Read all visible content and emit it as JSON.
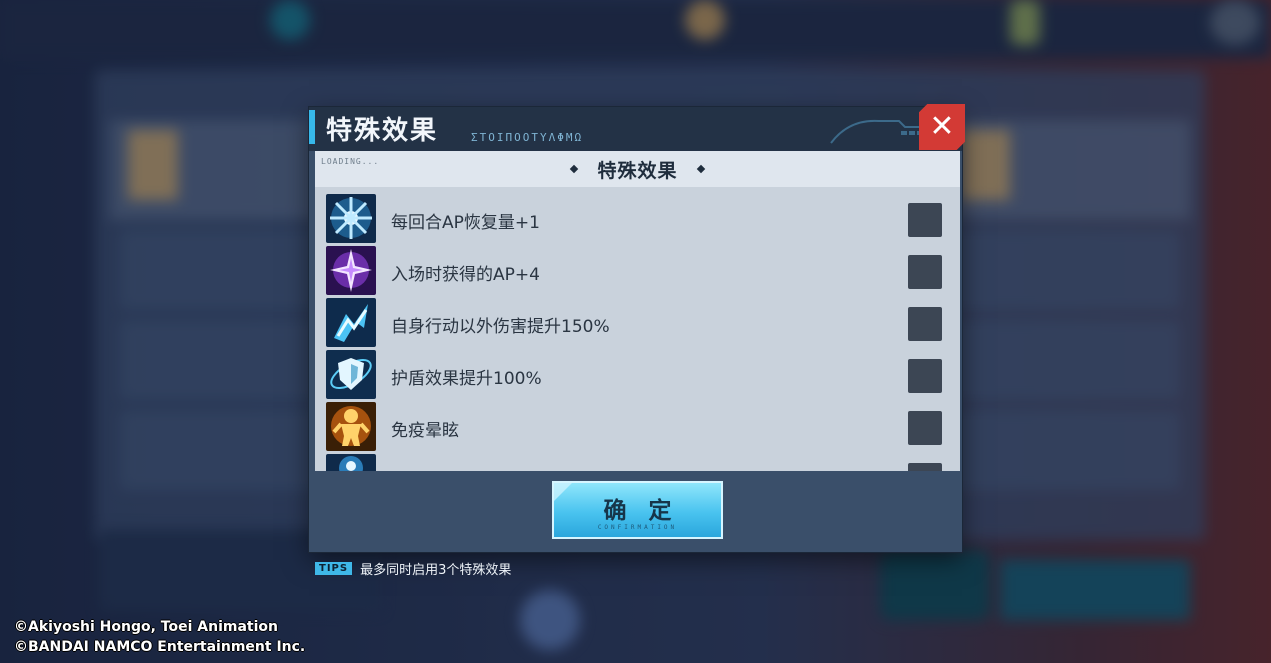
{
  "dialog": {
    "title": "特殊效果",
    "title_sub": "ΣΤΟΙΠΟΟΤΥΛΦΜΩ",
    "loading": "LOADING...",
    "subhead": "特殊效果",
    "effects": [
      {
        "label": "每回合AP恢复量+1",
        "icon": "burst-icon",
        "checked": false
      },
      {
        "label": "入场时获得的AP+4",
        "icon": "star-sparkle-icon",
        "checked": false
      },
      {
        "label": "自身行动以外伤害提升150%",
        "icon": "slash-icon",
        "checked": false
      },
      {
        "label": "护盾效果提升100%",
        "icon": "shield-icon",
        "checked": false
      },
      {
        "label": "免疫晕眩",
        "icon": "figure-icon",
        "checked": false
      },
      {
        "label": "",
        "icon": "partial-icon",
        "checked": false
      }
    ],
    "confirm_label": "确定",
    "confirm_sub": "CONFIRMATION"
  },
  "tips": {
    "tag": "TIPS",
    "text": "最多同时启用3个特殊效果"
  },
  "copyright": {
    "line1": "©Akiyoshi Hongo, Toei Animation",
    "line2": "©BANDAI NAMCO Entertainment Inc."
  },
  "colors": {
    "accent": "#37b8ea",
    "close": "#d33a35",
    "panel": "#c9d2dc",
    "checkbox": "#3c4654"
  }
}
